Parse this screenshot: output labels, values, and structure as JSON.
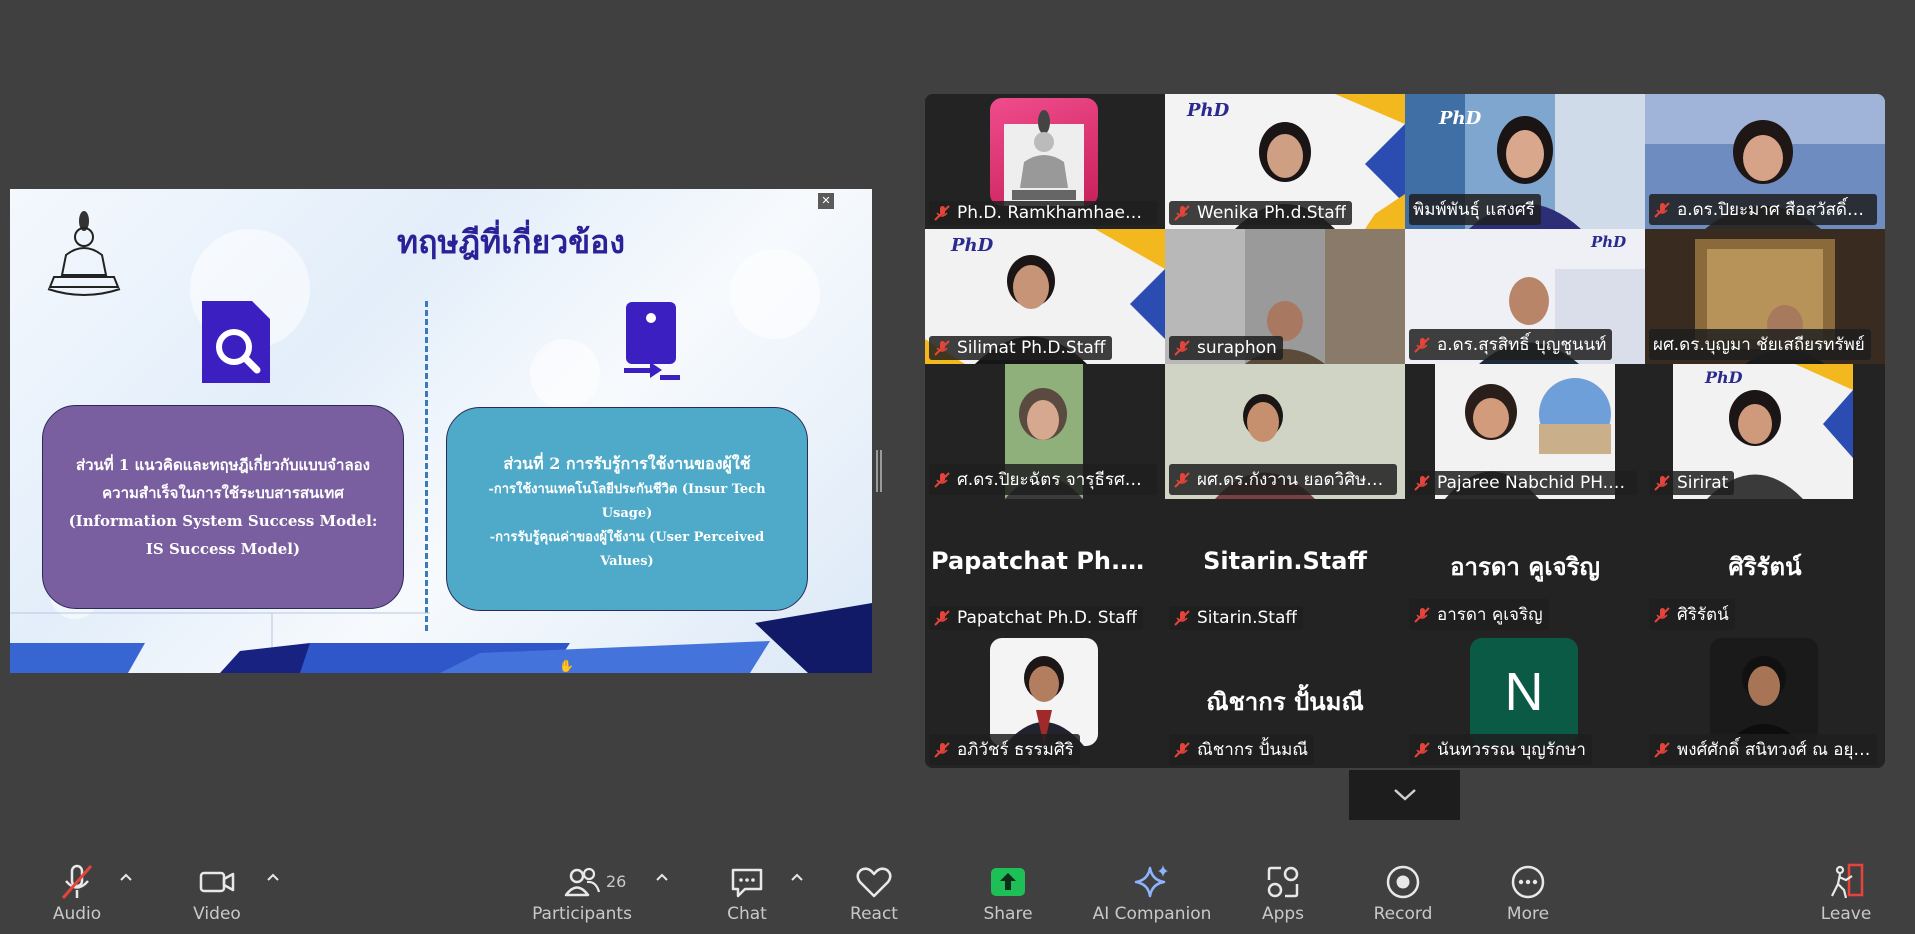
{
  "slide": {
    "title": "ทฤษฎีที่เกี่ยวข้อง",
    "part1_text": "ส่วนที่ 1 แนวคิดและทฤษฎีเกี่ยวกับแบบจำลองความสำเร็จในการใช้ระบบสารสนเทศ (Information System Success Model: IS Success Model)",
    "part2_head": "ส่วนที่ 2 การรับรู้การใช้งานของผู้ใช้",
    "part2_line1": "-การใช้งานเทคโนโลยีประกันชีวิต (Insur Tech Usage)",
    "part2_line2": "-การรับรู้คุณค่าของผู้ใช้งาน (User Perceived Values)",
    "colors": {
      "title": "#2a2196",
      "box1": "#7a5fa0",
      "box2": "#4eaac8",
      "icon": "#3b1fc0"
    }
  },
  "gallery": {
    "tiles": [
      {
        "name": "Ph.D. Ramkhamhaeng ...",
        "kind": "avatar-logo"
      },
      {
        "name": "Wenika Ph.d.Staff",
        "kind": "video"
      },
      {
        "name": "พิมพ์พันธุ์ แสงศรี",
        "kind": "video",
        "active": true
      },
      {
        "name": "อ.ดร.ปิยะมาศ  สือสวัสดิ์ว...",
        "kind": "video"
      },
      {
        "name": "Silimat Ph.D.Staff",
        "kind": "video"
      },
      {
        "name": "suraphon",
        "kind": "video"
      },
      {
        "name": "อ.ดร.สุรสิทธิ์ บุญชูนนท์",
        "kind": "video"
      },
      {
        "name": "ผศ.ดร.บุญมา ชัยเสถียรทรัพย์",
        "kind": "video"
      },
      {
        "name": "ศ.ดร.ปิยะฉัตร จารุธีรศานต์",
        "kind": "video"
      },
      {
        "name": "ผศ.ดร.กังวาน ยอดวิศิษฎ์ศั...",
        "kind": "video"
      },
      {
        "name": "Pajaree Nabchid PH.D ...",
        "kind": "video"
      },
      {
        "name": "Sirirat",
        "kind": "video"
      },
      {
        "name": "Papatchat Ph.D. Staff",
        "big": "Papatchat  Ph.D....",
        "kind": "name"
      },
      {
        "name": "Sitarin.Staff",
        "big": "Sitarin.Staff",
        "kind": "name"
      },
      {
        "name": "อารดา คูเจริญ",
        "big": "อารดา คูเจริญ",
        "kind": "name"
      },
      {
        "name": "ศิริรัตน์",
        "big": "ศิริรัตน์",
        "kind": "name"
      },
      {
        "name": "อภิวัชร์ ธรรมศิริ",
        "kind": "avatar-photo"
      },
      {
        "name": "ณิชากร ปั้นมณี",
        "big": "ณิชากร ปั้นมณี",
        "kind": "name"
      },
      {
        "name": "นันทวรรณ บุญรักษา",
        "initial": "N",
        "kind": "avatar-initial"
      },
      {
        "name": "พงศ์ศักดิ์ สนิทวงศ์ ณ อยุธ...",
        "kind": "avatar-photo"
      }
    ],
    "badge": "PhD"
  },
  "toolbar": {
    "audio": "Audio",
    "video": "Video",
    "participants": "Participants",
    "participants_count": "26",
    "chat": "Chat",
    "react": "React",
    "share": "Share",
    "ai": "AI Companion",
    "apps": "Apps",
    "record": "Record",
    "more": "More",
    "leave": "Leave",
    "colors": {
      "share": "#1fbf57",
      "muted": "#e5443a"
    }
  }
}
